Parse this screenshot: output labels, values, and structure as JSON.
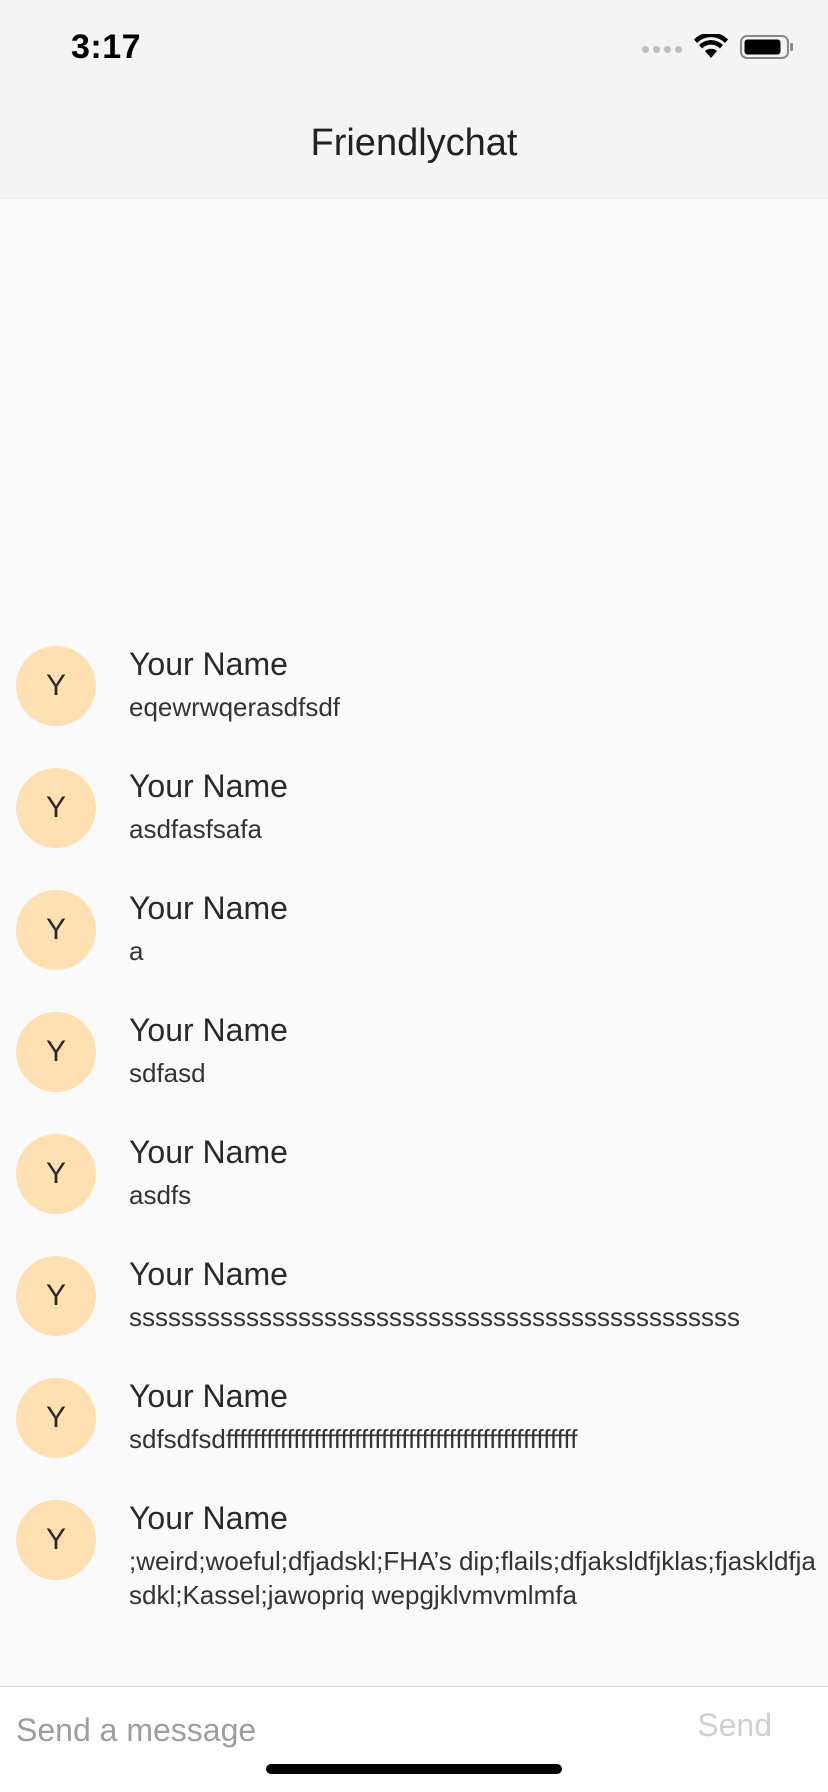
{
  "status_bar": {
    "time": "3:17",
    "icons": [
      "cellular-signal-icon",
      "wifi-icon",
      "battery-icon"
    ]
  },
  "header": {
    "title": "Friendlychat"
  },
  "colors": {
    "avatar_bg": "#ffe0b2",
    "send_disabled": "#d0d0d0",
    "background": "#fafafa"
  },
  "messages": [
    {
      "initial": "Y",
      "name": "Your Name",
      "text": "eqewrwqerasdfsdf"
    },
    {
      "initial": "Y",
      "name": "Your Name",
      "text": "asdfasfsafa"
    },
    {
      "initial": "Y",
      "name": "Your Name",
      "text": "a"
    },
    {
      "initial": "Y",
      "name": "Your Name",
      "text": "sdfasd"
    },
    {
      "initial": "Y",
      "name": "Your Name",
      "text": "asdfs"
    },
    {
      "initial": "Y",
      "name": "Your Name",
      "text": "sssssssssssssssssssssssssssssssssssssssssssssss"
    },
    {
      "initial": "Y",
      "name": "Your Name",
      "text": "sdfsdfsdffffffffffffffffffffffffffffffffffffffffffffffffffff"
    },
    {
      "initial": "Y",
      "name": "Your Name",
      "text": ";weird;woeful;dfjadskl;FHA’s dip;flails;dfjaksldfjklas;fjaskldfjasdkl;Kassel;jawopriq wepgjklvmvmlmfa"
    }
  ],
  "composer": {
    "placeholder": "Send a message",
    "value": "",
    "send_label": "Send"
  }
}
